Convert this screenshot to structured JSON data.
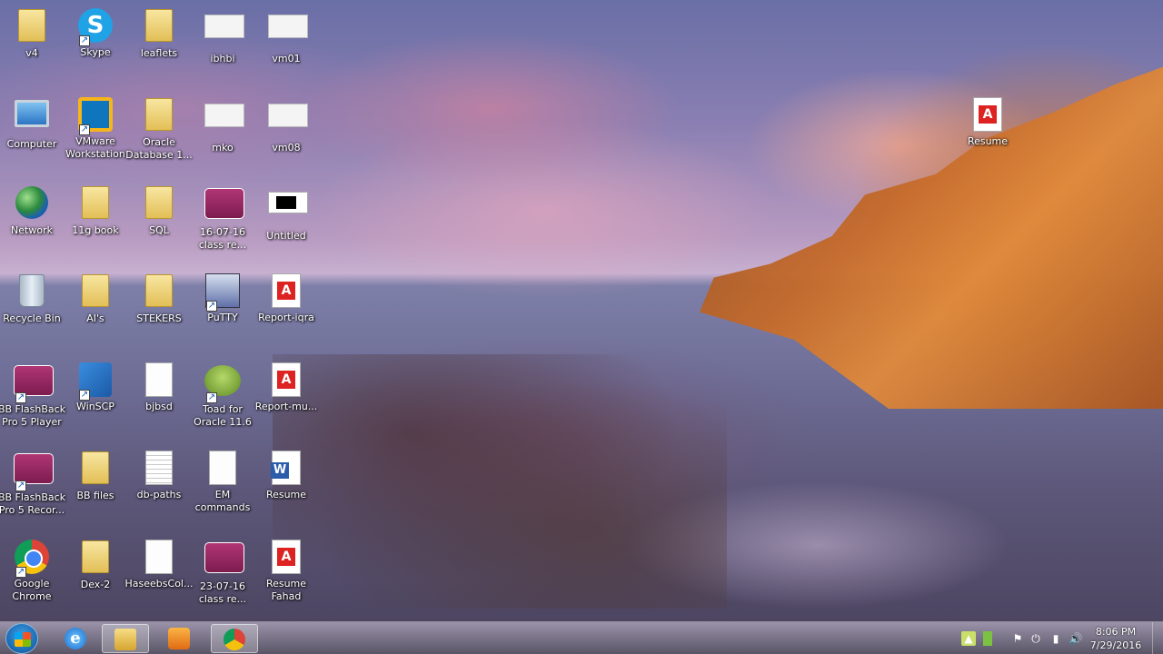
{
  "desktop": {
    "icons": [
      {
        "label": "v4"
      },
      {
        "label": "Skype"
      },
      {
        "label": "leaflets"
      },
      {
        "label": "ibhbi"
      },
      {
        "label": "vm01"
      },
      {
        "label": "Computer"
      },
      {
        "label": "VMware Workstation"
      },
      {
        "label": "Oracle Database 1..."
      },
      {
        "label": "mko"
      },
      {
        "label": "vm08"
      },
      {
        "label": "Network"
      },
      {
        "label": "11g book"
      },
      {
        "label": "SQL"
      },
      {
        "label": "16-07-16 class re..."
      },
      {
        "label": "Untitled"
      },
      {
        "label": "Recycle Bin"
      },
      {
        "label": "AI's"
      },
      {
        "label": "STEKERS"
      },
      {
        "label": "PuTTY"
      },
      {
        "label": "Report-iqra"
      },
      {
        "label": "BB FlashBack Pro 5 Player"
      },
      {
        "label": "WinSCP"
      },
      {
        "label": "bjbsd"
      },
      {
        "label": "Toad for Oracle 11.6"
      },
      {
        "label": "Report-mu..."
      },
      {
        "label": "BB FlashBack Pro 5 Recor..."
      },
      {
        "label": "BB files"
      },
      {
        "label": "db-paths"
      },
      {
        "label": "EM commands"
      },
      {
        "label": "Resume"
      },
      {
        "label": "Google Chrome"
      },
      {
        "label": "Dex-2"
      },
      {
        "label": "HaseebsCol..."
      },
      {
        "label": "23-07-16 class re..."
      },
      {
        "label": "Resume Fahad"
      },
      {
        "label": "Resume"
      }
    ]
  },
  "taskbar": {
    "pinned": [
      {
        "icon": "internet-explorer-icon"
      },
      {
        "icon": "windows-explorer-icon"
      },
      {
        "icon": "media-player-icon"
      },
      {
        "icon": "google-chrome-icon"
      }
    ],
    "clock": {
      "time": "8:06 PM",
      "date": "7/29/2016"
    }
  },
  "colors": {
    "taskbar": "#4a4560",
    "pdf_red": "#d22222",
    "word_blue": "#2a5caa"
  }
}
